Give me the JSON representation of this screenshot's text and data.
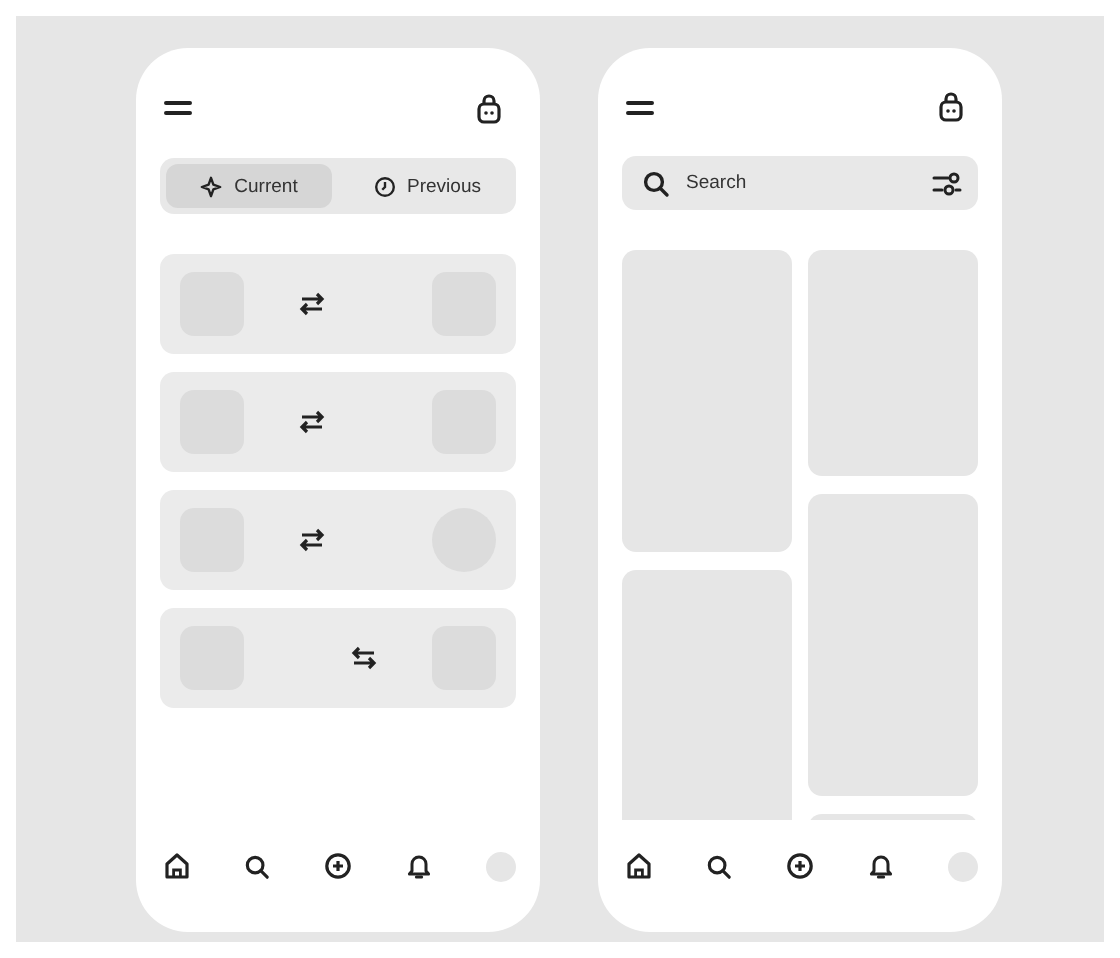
{
  "screens": [
    {
      "kind": "transfers",
      "tabs": [
        {
          "label": "Current",
          "selected": true
        },
        {
          "label": "Previous",
          "selected": false
        }
      ],
      "cards": [
        {
          "kind": "standard"
        },
        {
          "kind": "standard"
        },
        {
          "kind": "rounded"
        },
        {
          "kind": "reversed"
        }
      ]
    },
    {
      "kind": "browse",
      "search": {
        "placeholder": "Search"
      }
    }
  ]
}
